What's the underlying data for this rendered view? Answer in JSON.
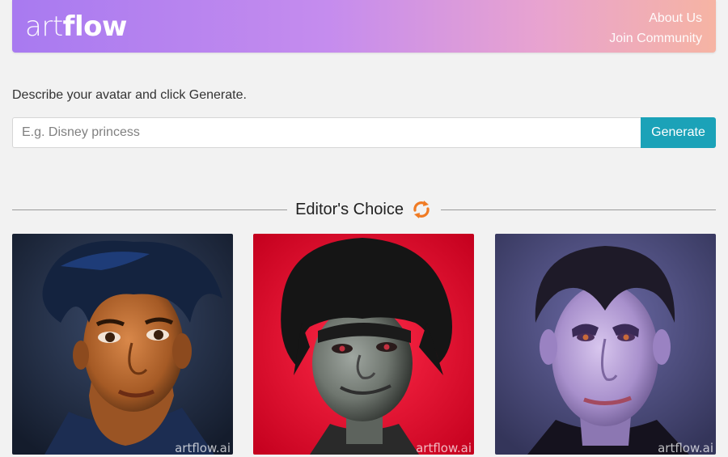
{
  "header": {
    "logo_light": "art",
    "logo_bold": "flow",
    "nav": [
      "About Us",
      "Join Community"
    ],
    "gradient": [
      "#a87af0",
      "#f6b4a3"
    ]
  },
  "prompt": {
    "instructions": "Describe your avatar and click Generate.",
    "placeholder": "E.g. Disney princess",
    "value": "",
    "button_label": "Generate",
    "button_color": "#1ba2b8"
  },
  "editors_choice": {
    "title": "Editor's Choice",
    "refresh_icon": "refresh-icon",
    "refresh_color": "#f07b24",
    "cards": [
      {
        "subject": "young man with dark blue hair portrait",
        "watermark": "artflow.ai"
      },
      {
        "subject": "green-skinned man with black hair on red background",
        "watermark": "artflow.ai"
      },
      {
        "subject": "pale vampire man with dark slicked hair",
        "watermark": "artflow.ai"
      }
    ]
  }
}
